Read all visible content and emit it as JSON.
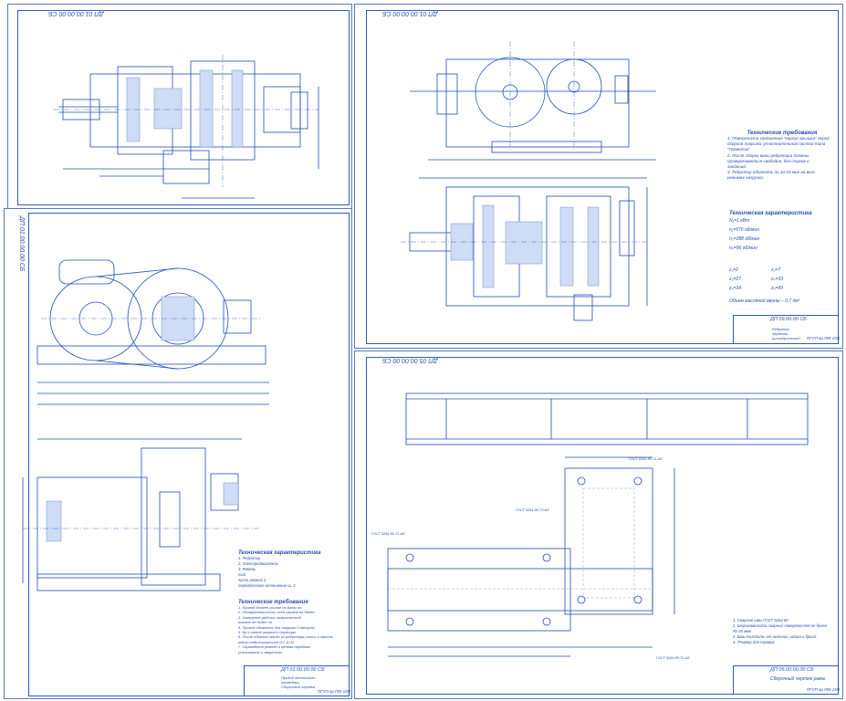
{
  "sheets": {
    "top_left": {
      "stamp": "ДП 01.00.00.00 СБ"
    },
    "top_right": {
      "stamp": "ДП 01.00.00.00 СБ",
      "notes_title": "Технические требования",
      "notes": [
        "1. Поверхности соединения \"корпус-крышка\" перед",
        "сборкой покрыть уплотнительной пастой типа",
        "\"Герметик\".",
        "2. После сборки валы редуктора должны",
        "проворачиваться свободно, без стуков и",
        "заеданий.",
        "3. Редуктор обкатать по 10-15 мин на всех",
        "режимах нагрузки."
      ],
      "char_title": "Техническая характеристика",
      "char_lines": [
        "N₁=1 кВт",
        "n₁=576 об/мин",
        "n₂=288 об/мин",
        "n₃=96 об/мин"
      ],
      "gear_lines_left": [
        "z₁=2",
        "z₃=27",
        "z₅=34"
      ],
      "gear_lines_right": [
        "z₂=7",
        "z₄=33",
        "z₆=99"
      ],
      "oil_note": "Объем масляной ванны – 0,7 дм³",
      "title_code": "ДП 09.00.00 СБ",
      "title_name": "Редуктор червячно-цилиндрический",
      "title_group": "ПГУП гр.ПМ-15П"
    },
    "left": {
      "stamp": "ДП 01.00.00.00 СБ",
      "char_title": "Техническая характеристика",
      "char_lines": [
        "1. Редуктор",
        "2. Электродвигатель",
        "3. Ремень",
        "тип",
        "число ремней 2",
        "передаточное отношение Uₚ 3"
      ],
      "req_title": "Технические требования",
      "req_lines": [
        "1. Привод должен усилие на Валы nn",
        "2. Непараллельность осей шкивов не более",
        "3. Смещение рабочих поверхностей",
        "шкивов не более nn",
        "4. Привод обкатать без нагрузки 3 минуты",
        "5. Кр е шение шкивов в ступицах",
        "6. После обкатки масло из редуктора слить и залить",
        "масло индустриальное И-Г-А-32",
        "7. Ограждения ремней и цепная передача",
        "установить и закрепить"
      ],
      "title_code": "ДП 01.00.00.00 СБ",
      "title_name": "Привод ленточного конвейера. Сборочный чертеж",
      "title_group": "ПГУП гр.ПМ-15П"
    },
    "bottom_right": {
      "stamp": "ДП 05.00.00.00 СБ",
      "notes": [
        "1. Сварные швы ГОСТ 5264-80",
        "2. Шероховатость сварных поверхностей не более",
        "Rz 40 мкм",
        "3. Швы очистить от окалины, шлака и брызг.",
        "4. *Размер для справок"
      ],
      "weld_labels": [
        "ГОСТ 5264-80-Т1-Δ5",
        "ГОСТ 5264-80-Т3-Δ5",
        "ГОСТ 5264-80-Т1-Δ5",
        "ГОСТ 5264-80-Т1-Δ5"
      ],
      "title_code": "ДП 05.00.00.00 СБ",
      "title_name": "Сборочный чертеж рамы",
      "title_group": "ПГУП гр.ПМ-15П"
    }
  },
  "colors": {
    "line": "#1f4fb5",
    "light": "#6f8fd8",
    "fill": "#cfdcf5"
  }
}
